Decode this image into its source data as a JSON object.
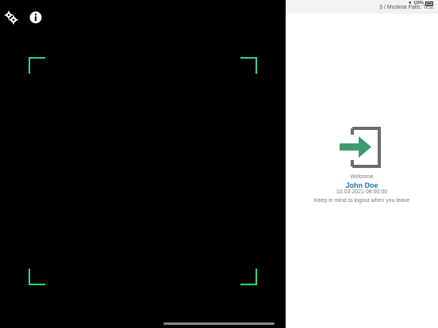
{
  "status_bar": {
    "location_text": "3 / Muskrat Falls: Test",
    "battery_text": "100%"
  },
  "toolbar": {
    "settings_icon": "gear-icon",
    "info_icon": "info-icon"
  },
  "scanner": {
    "frame_color": "#2fd38a"
  },
  "welcome_panel": {
    "icon": "login-arrow-icon",
    "welcome_label": "Welcome",
    "user_name": "John Doe",
    "login_datetime": "10.03.2021 08:00:00",
    "logout_hint": "Keep in mind to logout when you leave",
    "accent_color": "#1a73b8",
    "arrow_color": "#3f9a72"
  }
}
